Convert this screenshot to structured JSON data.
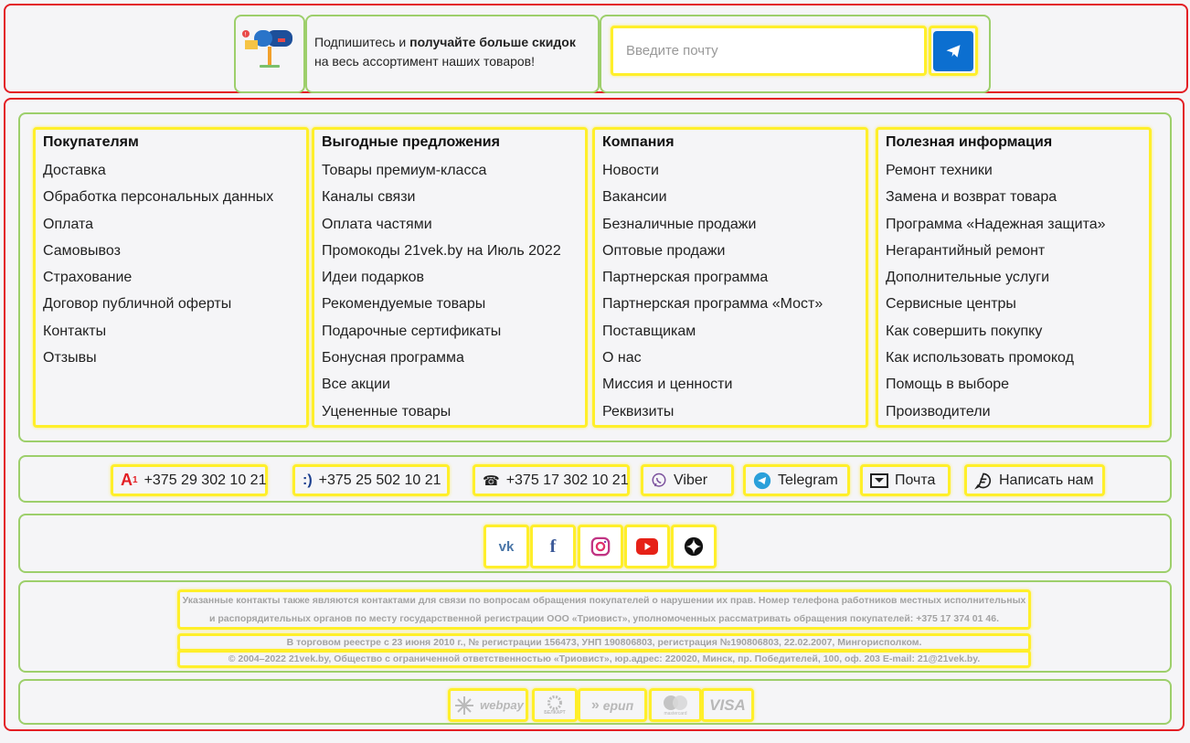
{
  "subscribe": {
    "text_prefix": "Подпишитесь и ",
    "text_bold": "получайте больше скидок",
    "text_suffix": "на весь ассортимент наших товаров!",
    "email_placeholder": "Введите почту"
  },
  "columns": [
    {
      "title": "Покупателям",
      "links": [
        "Доставка",
        "Обработка персональных данных",
        "Оплата",
        "Самовывоз",
        "Страхование",
        "Договор публичной оферты",
        "Контакты",
        "Отзывы"
      ]
    },
    {
      "title": "Выгодные предложения",
      "links": [
        "Товары премиум-класса",
        "Каналы связи",
        "Оплата частями",
        "Промокоды 21vek.by на Июль 2022",
        "Идеи подарков",
        "Рекомендуемые товары",
        "Подарочные сертификаты",
        "Бонусная программа",
        "Все акции",
        "Уцененные товары"
      ]
    },
    {
      "title": "Компания",
      "links": [
        "Новости",
        "Вакансии",
        "Безналичные продажи",
        "Оптовые продажи",
        "Партнерская программа",
        "Партнерская программа «Мост»",
        "Поставщикам",
        "О нас",
        "Миссия и ценности",
        "Реквизиты"
      ]
    },
    {
      "title": "Полезная информация",
      "links": [
        "Ремонт техники",
        "Замена и возврат товара",
        "Программа «Надежная защита»",
        "Негарантийный ремонт",
        "Дополнительные услуги",
        "Сервисные центры",
        "Как совершить покупку",
        "Как использовать промокод",
        "Помощь в выборе",
        "Производители"
      ]
    }
  ],
  "contacts": [
    {
      "icon": "a1-logo-icon",
      "label": "+375 29 302 10 21"
    },
    {
      "icon": "life-logo-icon",
      "label": "+375 25 502 10 21"
    },
    {
      "icon": "phone-icon",
      "label": "+375 17 302 10 21"
    },
    {
      "icon": "viber-icon",
      "label": "Viber"
    },
    {
      "icon": "telegram-icon",
      "label": "Telegram"
    },
    {
      "icon": "mail-icon",
      "label": "Почта"
    },
    {
      "icon": "chat-icon",
      "label": "Написать нам"
    }
  ],
  "social": [
    "vk-icon",
    "facebook-icon",
    "instagram-icon",
    "youtube-icon",
    "zen-icon"
  ],
  "legal": {
    "line1": "Указанные контакты также являются контактами для связи по вопросам обращения покупателей о нарушении их прав. Номер телефона работников местных исполнительных",
    "line2": "и распорядительных органов по месту государственной регистрации ООО «Триовист», уполномоченных рассматривать обращения покупателей: +375 17 374 01 46.",
    "registry": "В торговом реестре с 23 июня 2010 г., № регистрации 156473, УНП 190806803, регистрация №190806803, 22.02.2007, Мингорисполком.",
    "copyright": "© 2004–2022 21vek.by, Общество с ограниченной ответственностью «Триовист», юр.адрес: 220020, Минск, пр. Победителей, 100, оф. 203 E-mail: 21@21vek.by."
  },
  "payments": {
    "webpay": "webpay",
    "belkart": "БЕЛКАРТ",
    "erip": "ерип",
    "mastercard": "mastercard",
    "visa": "VISA"
  },
  "colors": {
    "accent_blue": "#0c6fd0",
    "highlight_yellow": "#ffef2a",
    "frame_green": "#9dcf6b",
    "frame_red": "#e31e24"
  }
}
